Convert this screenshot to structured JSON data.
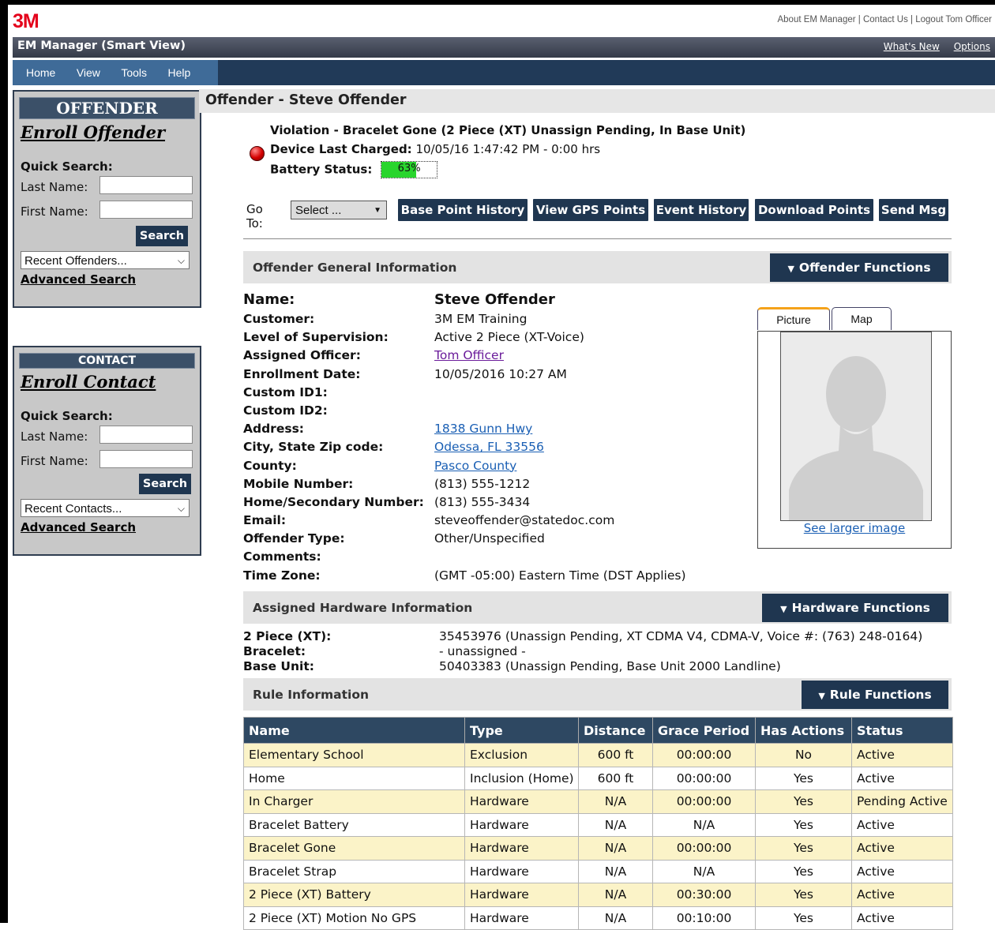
{
  "brand": "3M",
  "top_links": [
    "About EM Manager",
    "Contact Us",
    "Logout Tom Officer"
  ],
  "app": {
    "title": "EM Manager (Smart View)",
    "links": [
      "What's New",
      "Options"
    ]
  },
  "nav": [
    "Home",
    "View",
    "Tools",
    "Help"
  ],
  "offender_panel": {
    "header": "OFFENDER",
    "enroll": "Enroll Offender",
    "quick_search": "Quick Search:",
    "last_name_label": "Last Name:",
    "first_name_label": "First Name:",
    "last_name_value": "",
    "first_name_value": "",
    "search": "Search",
    "recent": "Recent Offenders...",
    "advanced": "Advanced Search"
  },
  "contact_panel": {
    "header": "CONTACT",
    "enroll": "Enroll Contact",
    "quick_search": "Quick Search:",
    "last_name_label": "Last Name:",
    "first_name_label": "First Name:",
    "last_name_value": "",
    "first_name_value": "",
    "search": "Search",
    "recent": "Recent Contacts...",
    "advanced": "Advanced Search"
  },
  "page_title": "Offender - Steve Offender",
  "status": {
    "violation": "Violation - Bracelet Gone (2 Piece (XT) Unassign Pending, In Base Unit)",
    "charged_label": "Device Last Charged:",
    "charged_value": "10/05/16 1:47:42 PM - 0:00 hrs",
    "battery_label": "Battery Status:",
    "battery_percent": 63,
    "battery_text": "63%",
    "alert_color": "#d40000"
  },
  "goto": {
    "label": "Go To:",
    "selected": "Select ..."
  },
  "toolbar": [
    "Base Point History",
    "View GPS Points",
    "Event History",
    "Download Points",
    "Send Msg"
  ],
  "general": {
    "title": "Offender General Information",
    "functions": "Offender Functions",
    "labels": [
      "Name:",
      "Customer:",
      "Level of Supervision:",
      "Assigned Officer:",
      "Enrollment Date:",
      "Custom ID1:",
      "Custom ID2:",
      "Address:",
      "City, State Zip code:",
      "County:",
      "Mobile Number:",
      "Home/Secondary Number:",
      "Email:",
      "Offender Type:",
      "Comments:",
      "Time Zone:"
    ],
    "values": [
      "Steve Offender",
      "3M EM Training",
      "Active 2 Piece (XT-Voice)",
      "Tom Officer",
      "10/05/2016 10:27 AM",
      "",
      "",
      "1838 Gunn Hwy",
      "Odessa, FL 33556",
      "Pasco County",
      "(813) 555-1212",
      "(813) 555-3434",
      "steveoffender@statedoc.com",
      "Other/Unspecified",
      "",
      "(GMT -05:00) Eastern Time (DST Applies)"
    ]
  },
  "photo": {
    "tabs": [
      "Picture",
      "Map"
    ],
    "see_larger": "See larger image"
  },
  "hardware": {
    "title": "Assigned Hardware Information",
    "functions": "Hardware Functions",
    "labels": [
      "2 Piece (XT):",
      "Bracelet:",
      "Base Unit:"
    ],
    "values": [
      "35453976 (Unassign Pending, XT CDMA V4, CDMA-V, Voice #: (763) 248-0164)",
      "- unassigned -",
      "50403383 (Unassign Pending, Base Unit 2000 Landline)"
    ]
  },
  "rules": {
    "title": "Rule Information",
    "functions": "Rule Functions",
    "columns": [
      "Name",
      "Type",
      "Distance",
      "Grace Period",
      "Has Actions",
      "Status"
    ],
    "rows": [
      [
        "Elementary School",
        "Exclusion",
        "600 ft",
        "00:00:00",
        "No",
        "Active"
      ],
      [
        "Home",
        "Inclusion (Home)",
        "600 ft",
        "00:00:00",
        "Yes",
        "Active"
      ],
      [
        "In Charger",
        "Hardware",
        "N/A",
        "00:00:00",
        "Yes",
        "Pending Active"
      ],
      [
        "Bracelet Battery",
        "Hardware",
        "N/A",
        "N/A",
        "Yes",
        "Active"
      ],
      [
        "Bracelet Gone",
        "Hardware",
        "N/A",
        "00:00:00",
        "Yes",
        "Active"
      ],
      [
        "Bracelet Strap",
        "Hardware",
        "N/A",
        "N/A",
        "Yes",
        "Active"
      ],
      [
        "2 Piece (XT) Battery",
        "Hardware",
        "N/A",
        "00:30:00",
        "Yes",
        "Active"
      ],
      [
        "2 Piece (XT) Motion No GPS",
        "Hardware",
        "N/A",
        "00:10:00",
        "Yes",
        "Active"
      ]
    ]
  }
}
